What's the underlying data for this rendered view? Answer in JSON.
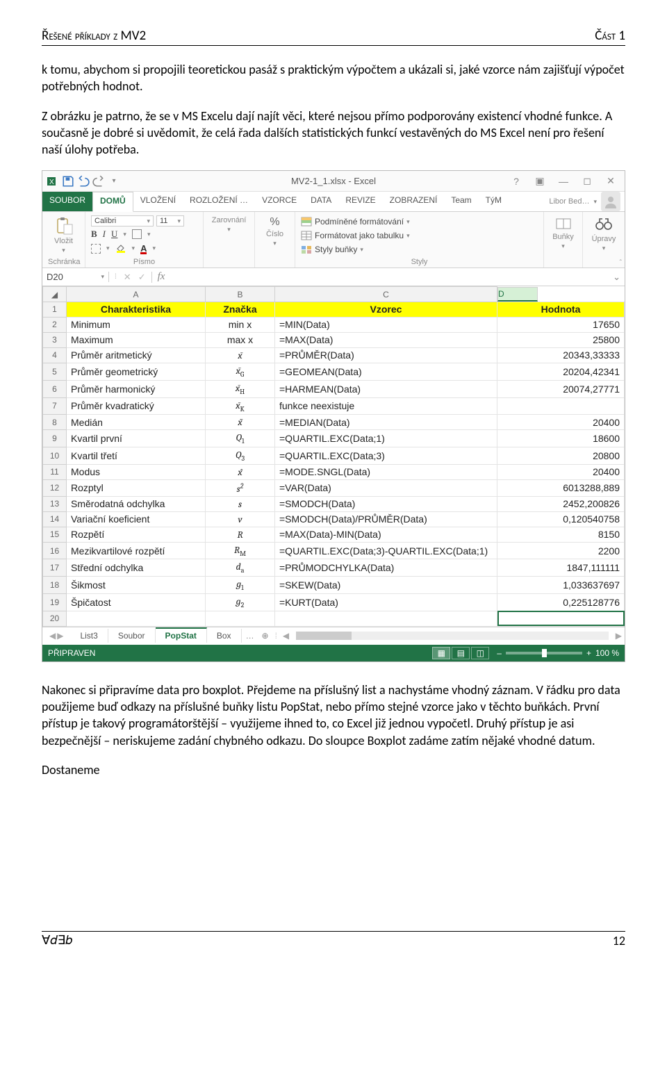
{
  "doc": {
    "header_left": "Řešené příklady z MV2",
    "header_right": "Část 1",
    "para1": "k tomu, abychom si propojili teoretickou pasáž s praktickým výpočtem a ukázali si, jaké vzorce nám zajišťují výpočet potřebných hodnot.",
    "para2": "Z obrázku je patrno, že se v MS Excelu dají najít věci, které nejsou přímo podporovány existencí vhodné funkce. A současně je dobré si uvědomit, že celá řada dalších statistických funkcí vestavěných do MS Excel není pro řešení naší úlohy potřeba.",
    "para3": "Nakonec si připravíme data pro boxplot. Přejdeme na příslušný list a nachystáme vhodný záznam. V řádku pro data použijeme buď odkazy na příslušné buňky listu PopStat, nebo přímo stejné vzorce jako v těchto buňkách. První přístup je takový programátorštější – využijeme ihned to, co Excel již jednou vypočetl. Druhý přístup je asi bezpečnější – neriskujeme zadání chybného odkazu. Do sloupce Boxplot zadáme zatím nějaké vhodné datum.",
    "para4": "Dostaneme",
    "footer_left": "∀𝑑∃𝑏",
    "footer_right": "12"
  },
  "excel": {
    "title": "MV2-1_1.xlsx - Excel",
    "tabs": [
      "SOUBOR",
      "DOMŮ",
      "VLOŽENÍ",
      "ROZLOŽENÍ …",
      "VZORCE",
      "DATA",
      "REVIZE",
      "ZOBRAZENÍ",
      "Team",
      "TýM"
    ],
    "active_tab": 1,
    "user": "Libor Bed…",
    "ribbon": {
      "paste": "Vložit",
      "clipboard": "Schránka",
      "font_name": "Calibri",
      "font_size": "11",
      "font_group": "Písmo",
      "align_group": "Zarovnání",
      "number_group": "Číslo",
      "number_pct": "%",
      "styles": {
        "cond": "Podmíněné formátování",
        "table": "Formátovat jako tabulku",
        "cell": "Styly buňky",
        "group": "Styly"
      },
      "cells": "Buňky",
      "editing": "Úpravy"
    },
    "formula": {
      "cell": "D20",
      "fx": "fx"
    },
    "columns": [
      "",
      "A",
      "B",
      "C",
      "D"
    ],
    "header_row": [
      "Charakteristika",
      "Značka",
      "Vzorec",
      "Hodnota"
    ],
    "rows": [
      {
        "n": "2",
        "a": "Minimum",
        "b": "min x",
        "c": "=MIN(Data)",
        "d": "17650"
      },
      {
        "n": "3",
        "a": "Maximum",
        "b": "max x",
        "c": "=MAX(Data)",
        "d": "25800"
      },
      {
        "n": "4",
        "a": "Průměr aritmetický",
        "bm": "x̄",
        "c": "=PRŮMĚR(Data)",
        "d": "20343,33333"
      },
      {
        "n": "5",
        "a": "Průměr geometrický",
        "bm": "x̄",
        "bsub": "G",
        "c": "=GEOMEAN(Data)",
        "d": "20204,42341"
      },
      {
        "n": "6",
        "a": "Průměr harmonický",
        "bm": "x̄",
        "bsub": "H",
        "c": "=HARMEAN(Data)",
        "d": "20074,27771"
      },
      {
        "n": "7",
        "a": "Průměr kvadratický",
        "bm": "x̄",
        "bsub": "K",
        "c": "funkce neexistuje",
        "d": ""
      },
      {
        "n": "8",
        "a": "Medián",
        "bm": "x̃",
        "c": "=MEDIAN(Data)",
        "d": "20400"
      },
      {
        "n": "9",
        "a": "Kvartil první",
        "bm": "Q",
        "bsub": "1",
        "c": "=QUARTIL.EXC(Data;1)",
        "d": "18600"
      },
      {
        "n": "10",
        "a": "Kvartil třetí",
        "bm": "Q",
        "bsub": "3",
        "c": "=QUARTIL.EXC(Data;3)",
        "d": "20800"
      },
      {
        "n": "11",
        "a": "Modus",
        "bm": "x̂",
        "c": "=MODE.SNGL(Data)",
        "d": "20400"
      },
      {
        "n": "12",
        "a": "Rozptyl",
        "bm": "s",
        "bsup": "2",
        "c": "=VAR(Data)",
        "d": "6013288,889"
      },
      {
        "n": "13",
        "a": "Směrodatná odchylka",
        "bm": "s",
        "c": "=SMODCH(Data)",
        "d": "2452,200826"
      },
      {
        "n": "14",
        "a": "Variační koeficient",
        "bm": "v",
        "c": "=SMODCH(Data)/PRŮMĚR(Data)",
        "d": "0,120540758"
      },
      {
        "n": "15",
        "a": "Rozpětí",
        "bm": "R",
        "c": "=MAX(Data)-MIN(Data)",
        "d": "8150"
      },
      {
        "n": "16",
        "a": "Mezikvartilové rozpětí",
        "bm": "R",
        "bsub": "M",
        "c": "=QUARTIL.EXC(Data;3)-QUARTIL.EXC(Data;1)",
        "d": "2200"
      },
      {
        "n": "17",
        "a": "Střední odchylka",
        "bm": "d",
        "bsub": "a",
        "c": "=PRŮMODCHYLKA(Data)",
        "d": "1847,111111"
      },
      {
        "n": "18",
        "a": "Šikmost",
        "bm": "g",
        "bsub": "1",
        "c": "=SKEW(Data)",
        "d": "1,033637697"
      },
      {
        "n": "19",
        "a": "Špičatost",
        "bm": "g",
        "bsub": "2",
        "c": "=KURT(Data)",
        "d": "0,225128776"
      }
    ],
    "sheets": [
      "List3",
      "Soubor",
      "PopStat",
      "Box"
    ],
    "active_sheet": 2,
    "sheet_more": "…",
    "status": "PŘIPRAVEN",
    "zoom": "100 %"
  }
}
